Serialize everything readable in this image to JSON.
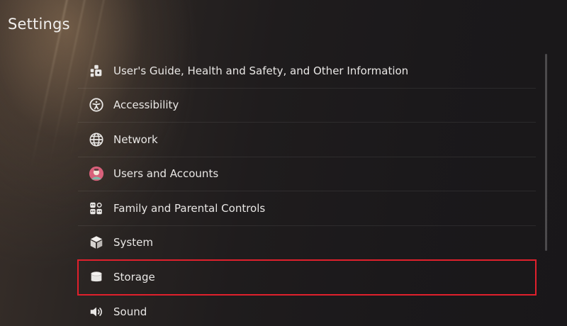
{
  "header": {
    "title": "Settings"
  },
  "settings_list": {
    "items": [
      {
        "label": "User's Guide, Health and Safety, and Other Information",
        "icon": "guide-icon"
      },
      {
        "label": "Accessibility",
        "icon": "accessibility-icon"
      },
      {
        "label": "Network",
        "icon": "globe-icon"
      },
      {
        "label": "Users and Accounts",
        "icon": "user-avatar-icon"
      },
      {
        "label": "Family and Parental Controls",
        "icon": "family-icon"
      },
      {
        "label": "System",
        "icon": "cube-icon"
      },
      {
        "label": "Storage",
        "icon": "storage-cylinder-icon"
      },
      {
        "label": "Sound",
        "icon": "speaker-icon"
      }
    ],
    "selected": "Storage"
  },
  "colors": {
    "selection_outline": "#e0202c",
    "text": "#e9e7e5"
  }
}
